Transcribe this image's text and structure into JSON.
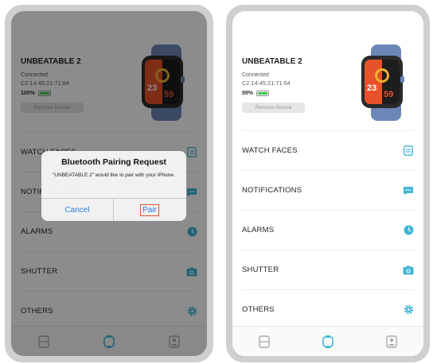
{
  "left": {
    "device": {
      "name": "UNBEATABLE 2",
      "status": "Connected",
      "mac": "C2:14:45:21:71:84",
      "battery": "100%",
      "battery_level": 1.0,
      "remove_label": "Remove Device"
    },
    "menu": [
      {
        "label": "WATCH FACES",
        "icon": "watch-faces-icon"
      },
      {
        "label": "NOTIFICATIONS",
        "icon": "chat-bubble-icon"
      },
      {
        "label": "ALARMS",
        "icon": "clock-icon"
      },
      {
        "label": "SHUTTER",
        "icon": "camera-icon"
      },
      {
        "label": "OTHERS",
        "icon": "gear-icon"
      }
    ],
    "dialog": {
      "title": "Bluetooth Pairing Request",
      "message": "“UNBEATABLE 2” would like to pair with your iPhone.",
      "cancel_label": "Cancel",
      "pair_label": "Pair"
    }
  },
  "right": {
    "device": {
      "name": "UNBEATABLE 2",
      "status": "Connected",
      "mac": "C2:14:45:21:71:64",
      "battery": "99%",
      "battery_level": 0.99,
      "remove_label": "Remove Device"
    },
    "menu": [
      {
        "label": "WATCH FACES",
        "icon": "watch-faces-icon"
      },
      {
        "label": "NOTIFICATIONS",
        "icon": "chat-bubble-icon"
      },
      {
        "label": "ALARMS",
        "icon": "clock-icon"
      },
      {
        "label": "SHUTTER",
        "icon": "camera-icon"
      },
      {
        "label": "OTHERS",
        "icon": "gear-icon"
      }
    ]
  },
  "watch_face": {
    "num_a": "23",
    "num_b": "59"
  },
  "colors": {
    "accent": "#3fb6d8",
    "battery": "#3dc64a",
    "dialog_button": "#2a7de1",
    "highlight": "#e0572a"
  },
  "tabs": [
    {
      "icon": "device-list-icon",
      "active": false
    },
    {
      "icon": "watch-icon",
      "active": true
    },
    {
      "icon": "profile-icon",
      "active": false
    }
  ]
}
